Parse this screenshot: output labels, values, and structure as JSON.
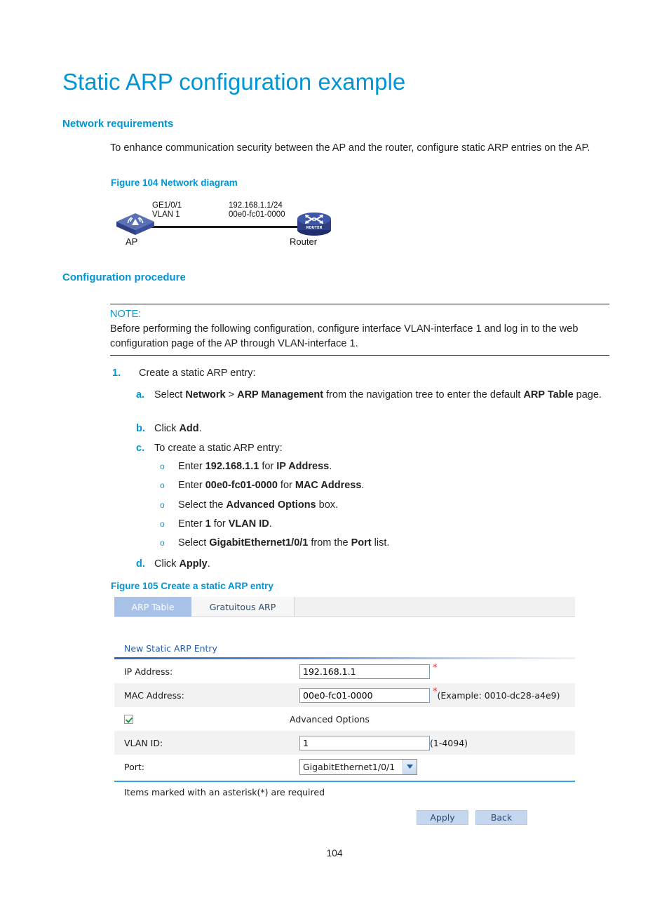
{
  "document": {
    "title": "Static ARP configuration example",
    "page_number": "104",
    "accent_color": "#0096d6"
  },
  "sections": {
    "network_requirements": {
      "heading": "Network requirements",
      "body": "To enhance communication security between the AP and the router, configure static ARP entries on the AP."
    },
    "figure_104": {
      "caption": "Figure 104 Network diagram",
      "labels": {
        "interface": "GE1/0/1",
        "vlan": "VLAN 1",
        "ip": "192.168.1.1/24",
        "mac": "00e0-fc01-0000",
        "left_device": "AP",
        "right_device": "Router",
        "router_badge": "ROUTER"
      }
    },
    "configuration_procedure": {
      "heading": "Configuration procedure",
      "note": {
        "label": "NOTE:",
        "body": "Before performing the following configuration, configure interface VLAN-interface 1 and log in to the web configuration page of the AP through VLAN-interface 1."
      },
      "step_1": {
        "number": "1.",
        "text": "Create a static ARP entry:"
      },
      "substeps": [
        {
          "marker": "a.",
          "html": "Select <b>Network</b> &gt; <b>ARP Management</b> from the navigation tree to enter the default <b>ARP Table</b> page."
        },
        {
          "marker": "b.",
          "html": "Click <b>Add</b>."
        },
        {
          "marker": "c.",
          "html": "To create a static ARP entry:"
        },
        {
          "marker": "d.",
          "html": "Click <b>Apply</b>."
        }
      ],
      "bullets": [
        {
          "marker": "o",
          "html": "Enter <b>192.168.1.1</b> for <b>IP Address</b>."
        },
        {
          "marker": "o",
          "html": "Enter <b>00e0-fc01-0000</b> for <b>MAC Address</b>."
        },
        {
          "marker": "o",
          "html": "Select the <b>Advanced Options</b> box."
        },
        {
          "marker": "o",
          "html": "Enter <b>1</b> for <b>VLAN ID</b>."
        },
        {
          "marker": "o",
          "html": "Select <b>GigabitEthernet1/0/1</b> from the <b>Port</b> list."
        }
      ]
    },
    "figure_105": {
      "caption": "Figure 105 Create a static ARP entry"
    }
  },
  "webui": {
    "tabs": [
      {
        "label": "ARP Table",
        "active": true
      },
      {
        "label": "Gratuitous ARP",
        "active": false
      }
    ],
    "panel_title": "New Static ARP Entry",
    "fields": {
      "ip_address": {
        "label": "IP Address:",
        "value": "192.168.1.1",
        "required_marker": "*",
        "hint": ""
      },
      "mac_address": {
        "label": "MAC Address:",
        "value": "00e0-fc01-0000",
        "required_marker": "*",
        "hint": "(Example: 0010-dc28-a4e9)"
      },
      "advanced_options": {
        "label": "Advanced Options",
        "checked": true
      },
      "vlan_id": {
        "label": "VLAN ID:",
        "value": "1",
        "hint": "(1-4094)"
      },
      "port": {
        "label": "Port:",
        "value": "GigabitEthernet1/0/1"
      }
    },
    "required_note": "Items marked with an asterisk(*) are required",
    "buttons": {
      "apply": "Apply",
      "back": "Back"
    }
  }
}
